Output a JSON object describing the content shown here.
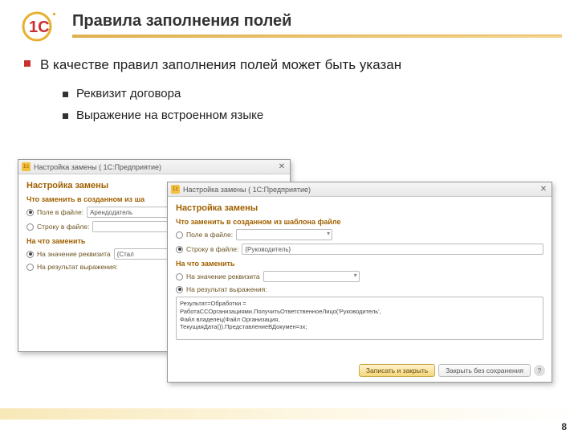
{
  "slide": {
    "title": "Правила заполнения полей",
    "bullet_main": "В качестве правил заполнения полей может быть указан",
    "sub1": "Реквизит договора",
    "sub2": "Выражение на встроенном языке",
    "page_number": "8"
  },
  "win1": {
    "title": "Настройка замены ( 1С:Предприятие)",
    "heading": "Настройка замены",
    "sec1": "Что заменить в созданном из ша",
    "r1": "Поле в файле:",
    "r1val": "Арендодатель",
    "r2": "Строку в файле:",
    "sec2": "На что заменить",
    "r3": "На значение реквизита",
    "r3val": "{Стал",
    "r4": "На результат выражения:"
  },
  "win2": {
    "title": "Настройка замены ( 1С:Предприятие)",
    "heading": "Настройка замены",
    "sec1": "Что заменить в созданном из шаблона файле",
    "r1": "Поле в файле:",
    "r2": "Строку в файле:",
    "r2val": "{Руководитель}",
    "sec2": "На что заменить",
    "r3": "На значение реквизита",
    "r4": "На результат выражения:",
    "code_l1": "Результат=Обработки =",
    "code_l2": "РаботаССОрганизациями.ПолучитьОтветственноеЛицо('Руководитель',",
    "code_l3": "Файл владелец(Файл Организация,",
    "code_l4": "ТекущаяДата()).ПредставлениеВДокумен=зх;",
    "btn_save": "Записать и закрыть",
    "btn_cancel": "Закрыть без сохранения"
  }
}
